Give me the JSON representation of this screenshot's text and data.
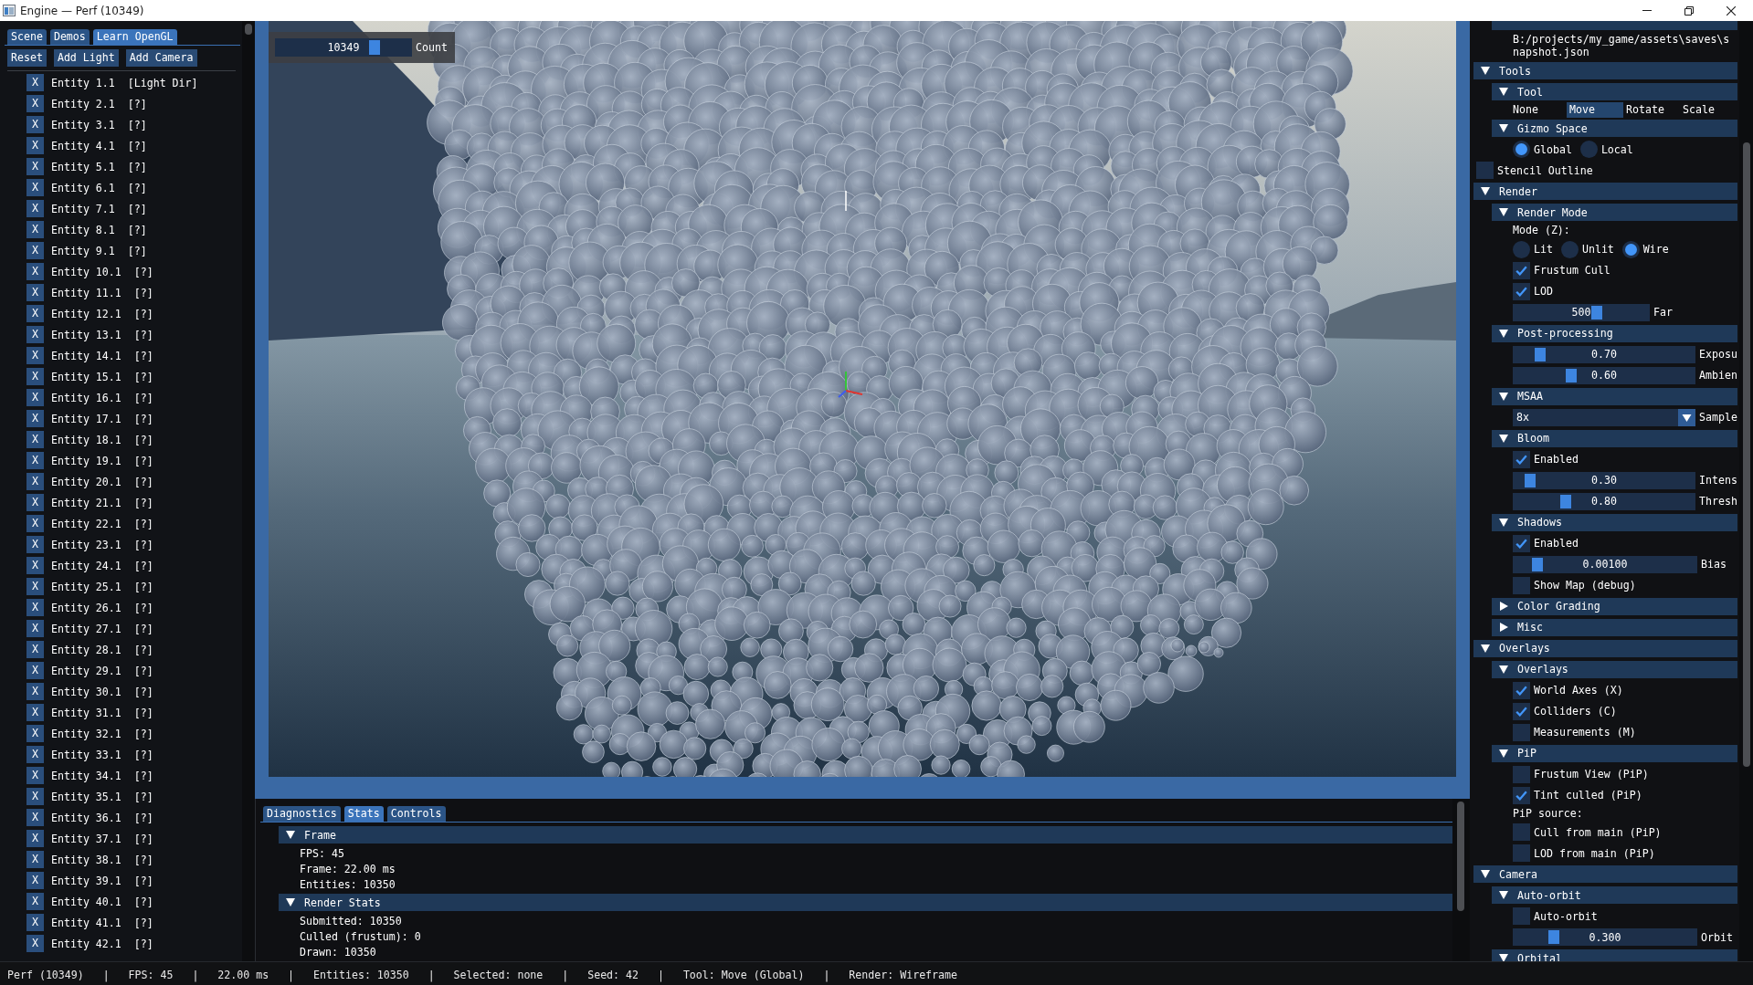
{
  "window": {
    "title": "Engine — Perf (10349)"
  },
  "scene_panel": {
    "tabs": [
      {
        "label": "Scene",
        "selected": false
      },
      {
        "label": "Demos",
        "selected": false
      },
      {
        "label": "Learn OpenGL",
        "selected": true
      }
    ],
    "buttons": [
      "Reset",
      "Add Light",
      "Add Camera"
    ],
    "entities": [
      {
        "button": "X",
        "label": "Entity 1.1  [Light Dir]"
      },
      {
        "button": "X",
        "label": "Entity 2.1  [?]"
      },
      {
        "button": "X",
        "label": "Entity 3.1  [?]"
      },
      {
        "button": "X",
        "label": "Entity 4.1  [?]"
      },
      {
        "button": "X",
        "label": "Entity 5.1  [?]"
      },
      {
        "button": "X",
        "label": "Entity 6.1  [?]"
      },
      {
        "button": "X",
        "label": "Entity 7.1  [?]"
      },
      {
        "button": "X",
        "label": "Entity 8.1  [?]"
      },
      {
        "button": "X",
        "label": "Entity 9.1  [?]"
      },
      {
        "button": "X",
        "label": "Entity 10.1  [?]"
      },
      {
        "button": "X",
        "label": "Entity 11.1  [?]"
      },
      {
        "button": "X",
        "label": "Entity 12.1  [?]"
      },
      {
        "button": "X",
        "label": "Entity 13.1  [?]"
      },
      {
        "button": "X",
        "label": "Entity 14.1  [?]"
      },
      {
        "button": "X",
        "label": "Entity 15.1  [?]"
      },
      {
        "button": "X",
        "label": "Entity 16.1  [?]"
      },
      {
        "button": "X",
        "label": "Entity 17.1  [?]"
      },
      {
        "button": "X",
        "label": "Entity 18.1  [?]"
      },
      {
        "button": "X",
        "label": "Entity 19.1  [?]"
      },
      {
        "button": "X",
        "label": "Entity 20.1  [?]"
      },
      {
        "button": "X",
        "label": "Entity 21.1  [?]"
      },
      {
        "button": "X",
        "label": "Entity 22.1  [?]"
      },
      {
        "button": "X",
        "label": "Entity 23.1  [?]"
      },
      {
        "button": "X",
        "label": "Entity 24.1  [?]"
      },
      {
        "button": "X",
        "label": "Entity 25.1  [?]"
      },
      {
        "button": "X",
        "label": "Entity 26.1  [?]"
      },
      {
        "button": "X",
        "label": "Entity 27.1  [?]"
      },
      {
        "button": "X",
        "label": "Entity 28.1  [?]"
      },
      {
        "button": "X",
        "label": "Entity 29.1  [?]"
      },
      {
        "button": "X",
        "label": "Entity 30.1  [?]"
      },
      {
        "button": "X",
        "label": "Entity 31.1  [?]"
      },
      {
        "button": "X",
        "label": "Entity 32.1  [?]"
      },
      {
        "button": "X",
        "label": "Entity 33.1  [?]"
      },
      {
        "button": "X",
        "label": "Entity 34.1  [?]"
      },
      {
        "button": "X",
        "label": "Entity 35.1  [?]"
      },
      {
        "button": "X",
        "label": "Entity 36.1  [?]"
      },
      {
        "button": "X",
        "label": "Entity 37.1  [?]"
      },
      {
        "button": "X",
        "label": "Entity 38.1  [?]"
      },
      {
        "button": "X",
        "label": "Entity 39.1  [?]"
      },
      {
        "button": "X",
        "label": "Entity 40.1  [?]"
      },
      {
        "button": "X",
        "label": "Entity 41.1  [?]"
      },
      {
        "button": "X",
        "label": "Entity 42.1  [?]"
      }
    ]
  },
  "viewport": {
    "count_slider": {
      "value": "10349",
      "level": 0.75,
      "label": "Count"
    }
  },
  "bottom_panel": {
    "tabs": [
      {
        "label": "Diagnostics",
        "selected": false
      },
      {
        "label": "Stats",
        "selected": true
      },
      {
        "label": "Controls",
        "selected": false
      }
    ],
    "sections": [
      {
        "title": "Frame",
        "expanded": true,
        "lines": [
          "FPS: 45",
          "Frame: 22.00 ms",
          "Entities: 10350"
        ]
      },
      {
        "title": "Render Stats",
        "expanded": true,
        "lines": [
          "Submitted: 10350",
          "Culled (frustum): 0",
          "Drawn: 10350"
        ]
      }
    ]
  },
  "inspector": [
    {
      "kind": "group",
      "children": [
        {
          "kind": "header_stub",
          "children": [
            {
              "kind": "text",
              "text": "B:/projects/my_game/assets\\saves\\snapshot.json"
            }
          ]
        }
      ]
    },
    {
      "kind": "header",
      "title": "Tools",
      "expanded": true,
      "children": [
        {
          "kind": "header",
          "title": "Tool",
          "expanded": true,
          "children": [
            {
              "kind": "selectables",
              "options": [
                {
                  "label": "None",
                  "selected": false
                },
                {
                  "label": "Move",
                  "selected": true
                },
                {
                  "label": "Rotate",
                  "selected": false
                },
                {
                  "label": "Scale",
                  "selected": false
                }
              ]
            }
          ]
        },
        {
          "kind": "header",
          "title": "Gizmo Space",
          "expanded": true,
          "children": [
            {
              "kind": "radios",
              "options": [
                {
                  "label": "Global",
                  "selected": true
                },
                {
                  "label": "Local",
                  "selected": false
                }
              ]
            }
          ]
        },
        {
          "kind": "checkbox",
          "text": "Stencil Outline",
          "checked": false
        }
      ]
    },
    {
      "kind": "header",
      "title": "Render",
      "expanded": true,
      "children": [
        {
          "kind": "header",
          "title": "Render Mode",
          "expanded": true,
          "children": [
            {
              "kind": "text",
              "text": "Mode (Z):"
            },
            {
              "kind": "radios",
              "options": [
                {
                  "label": "Lit",
                  "selected": false
                },
                {
                  "label": "Unlit",
                  "selected": false
                },
                {
                  "label": "Wire",
                  "selected": true
                }
              ]
            },
            {
              "kind": "checkbox",
              "text": "Frustum Cull",
              "checked": true
            },
            {
              "kind": "checkbox",
              "text": "LOD",
              "checked": true
            },
            {
              "kind": "short_slider",
              "value": "500",
              "level": 0.63,
              "label": "Far"
            }
          ]
        },
        {
          "kind": "header",
          "title": "Post-processing",
          "expanded": true,
          "children": [
            {
              "kind": "slider",
              "value": "0.70",
              "level": 0.12,
              "label": "Exposu"
            },
            {
              "kind": "slider",
              "value": "0.60",
              "level": 0.3,
              "label": "Ambien"
            }
          ]
        },
        {
          "kind": "header",
          "title": "MSAA",
          "expanded": true,
          "children": [
            {
              "kind": "combo",
              "value": "8x",
              "label": "Sample"
            }
          ]
        },
        {
          "kind": "header",
          "title": "Bloom",
          "expanded": true,
          "children": [
            {
              "kind": "checkbox",
              "text": "Enabled",
              "checked": true
            },
            {
              "kind": "slider",
              "value": "0.30",
              "level": 0.06,
              "label": "Intens"
            },
            {
              "kind": "slider",
              "value": "0.80",
              "level": 0.27,
              "label": "Thresh"
            }
          ]
        },
        {
          "kind": "header",
          "title": "Shadows",
          "expanded": true,
          "children": [
            {
              "kind": "checkbox",
              "text": "Enabled",
              "checked": true
            },
            {
              "kind": "slider",
              "value": "0.00100",
              "level": 0.1,
              "label": "Bias"
            },
            {
              "kind": "checkbox",
              "text": "Show Map (debug)",
              "checked": false
            }
          ]
        },
        {
          "kind": "header",
          "title": "Color Grading",
          "expanded": false
        },
        {
          "kind": "header",
          "title": "Misc",
          "expanded": false
        }
      ]
    },
    {
      "kind": "header",
      "title": "Overlays",
      "expanded": true,
      "children": [
        {
          "kind": "header",
          "title": "Overlays",
          "expanded": true,
          "children": [
            {
              "kind": "checkbox",
              "text": "World Axes (X)",
              "checked": true
            },
            {
              "kind": "checkbox",
              "text": "Colliders (C)",
              "checked": true
            },
            {
              "kind": "checkbox",
              "text": "Measurements (M)",
              "checked": false
            }
          ]
        },
        {
          "kind": "header",
          "title": "PiP",
          "expanded": true,
          "children": [
            {
              "kind": "checkbox",
              "text": "Frustum View (PiP)",
              "checked": false
            },
            {
              "kind": "checkbox",
              "text": "Tint culled (PiP)",
              "checked": true
            },
            {
              "kind": "text",
              "text": "PiP source:"
            },
            {
              "kind": "checkbox",
              "text": "Cull from main (PiP)",
              "checked": false
            },
            {
              "kind": "checkbox",
              "text": "LOD from main (PiP)",
              "checked": false
            }
          ]
        }
      ]
    },
    {
      "kind": "header",
      "title": "Camera",
      "expanded": true,
      "children": [
        {
          "kind": "header",
          "title": "Auto-orbit",
          "expanded": true,
          "children": [
            {
              "kind": "checkbox",
              "text": "Auto-orbit",
              "checked": false
            },
            {
              "kind": "slider",
              "value": "0.300",
              "level": 0.2,
              "label": "Orbit"
            }
          ]
        },
        {
          "kind": "header",
          "title": "Orbital",
          "expanded": true
        }
      ]
    }
  ],
  "status_bar": "Perf (10349)   |   FPS: 45   |   22.00 ms   |   Entities: 10350   |   Selected: none   |   Seed: 42   |   Tool: Move (Global)   |   Render: Wireframe"
}
